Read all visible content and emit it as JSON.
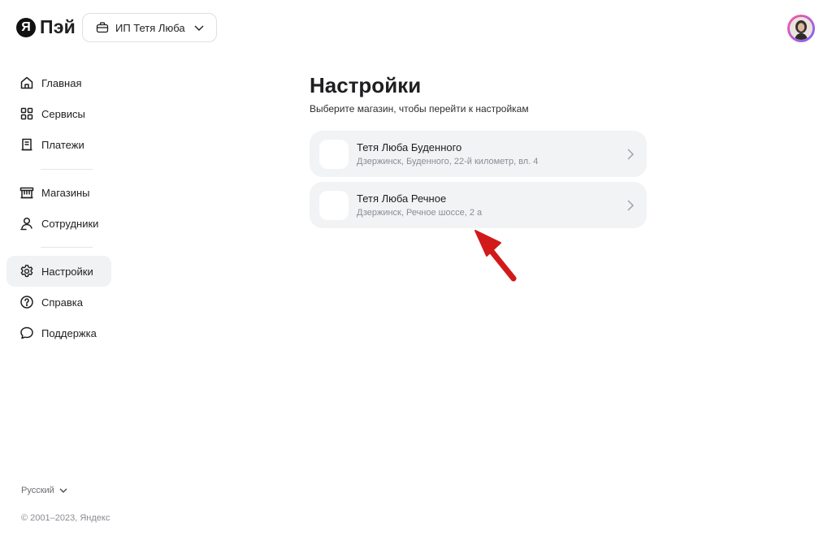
{
  "header": {
    "logo_mark": "Я",
    "logo_text": "Пэй",
    "org_switcher": {
      "label": "ИП Тетя Люба"
    }
  },
  "sidebar": {
    "items": [
      {
        "label": "Главная",
        "icon": "home-icon"
      },
      {
        "label": "Сервисы",
        "icon": "grid-icon"
      },
      {
        "label": "Платежи",
        "icon": "receipt-icon"
      },
      {
        "label": "Магазины",
        "icon": "store-icon"
      },
      {
        "label": "Сотрудники",
        "icon": "user-icon"
      },
      {
        "label": "Настройки",
        "icon": "gear-icon",
        "active": true
      },
      {
        "label": "Справка",
        "icon": "question-icon"
      },
      {
        "label": "Поддержка",
        "icon": "chat-icon"
      }
    ],
    "language": "Русский",
    "copyright": "© 2001–2023, Яндекс"
  },
  "main": {
    "title": "Настройки",
    "subtitle": "Выберите магазин, чтобы перейти к настройкам",
    "stores": [
      {
        "name": "Тетя Люба Буденного",
        "address": "Дзержинск, Буденного, 22-й километр, вл. 4"
      },
      {
        "name": "Тетя Люба Речное",
        "address": "Дзержинск, Речное шоссе, 2 а"
      }
    ]
  },
  "colors": {
    "accent_arrow": "#d11a1a",
    "card_bg": "#f2f3f5",
    "active_nav_bg": "#f1f2f4"
  }
}
